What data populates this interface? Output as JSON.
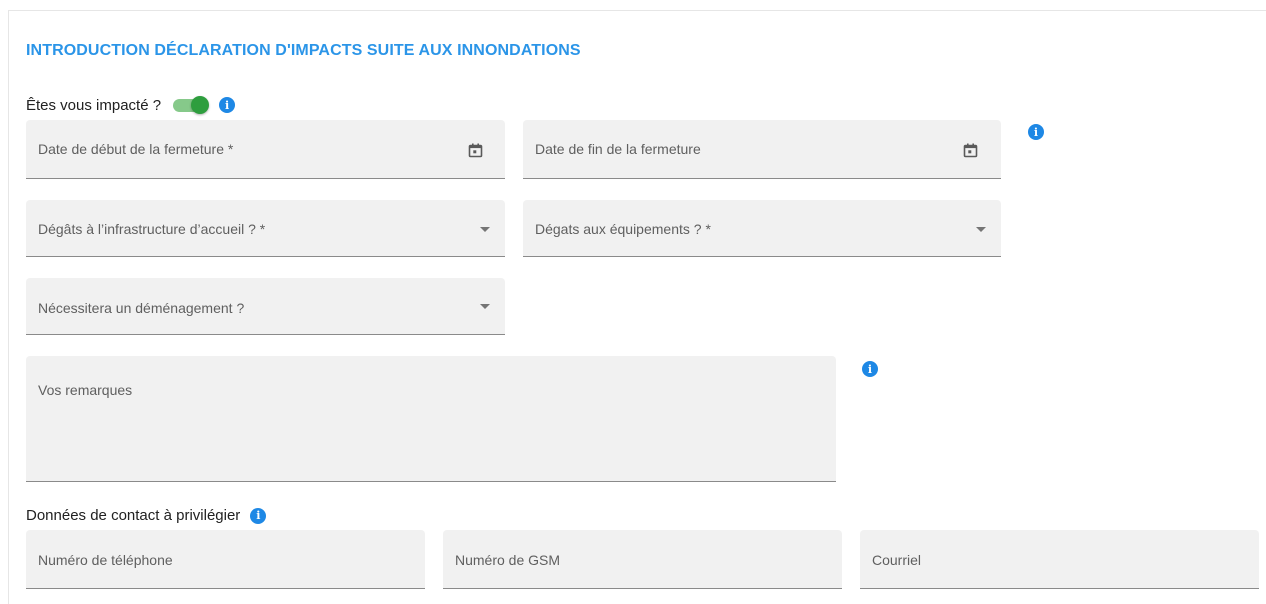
{
  "form": {
    "title": "INTRODUCTION DÉCLARATION D'IMPACTS SUITE AUX INNONDATIONS",
    "impacted": {
      "label": "Êtes vous impacté ?",
      "toggle_on": true
    },
    "closure_start": {
      "label": "Date de début de la fermeture *",
      "icon": "calendar-icon"
    },
    "closure_end": {
      "label": "Date de fin de la fermeture",
      "icon": "calendar-icon"
    },
    "infrastructure_damage": {
      "label": "Dégâts à l’infrastructure d’accueil ? *",
      "icon": "dropdown-arrow-icon"
    },
    "equipment_damage": {
      "label": "Dégats aux équipements ? *",
      "icon": "dropdown-arrow-icon"
    },
    "relocation": {
      "label": "Nécessitera un déménagement ?",
      "icon": "dropdown-arrow-icon"
    },
    "remarks": {
      "label": "Vos remarques"
    },
    "contact": {
      "section_label": "Données de contact à privilégier",
      "phone": {
        "label": "Numéro de téléphone"
      },
      "mobile": {
        "label": "Numéro de GSM"
      },
      "email": {
        "label": "Courriel"
      }
    }
  },
  "colors": {
    "title": "#2b95e8",
    "info_icon": "#1e88e5",
    "toggle_thumb": "#2e9e3e",
    "toggle_track": "#86c98a",
    "field_bg": "#f1f1f1"
  }
}
